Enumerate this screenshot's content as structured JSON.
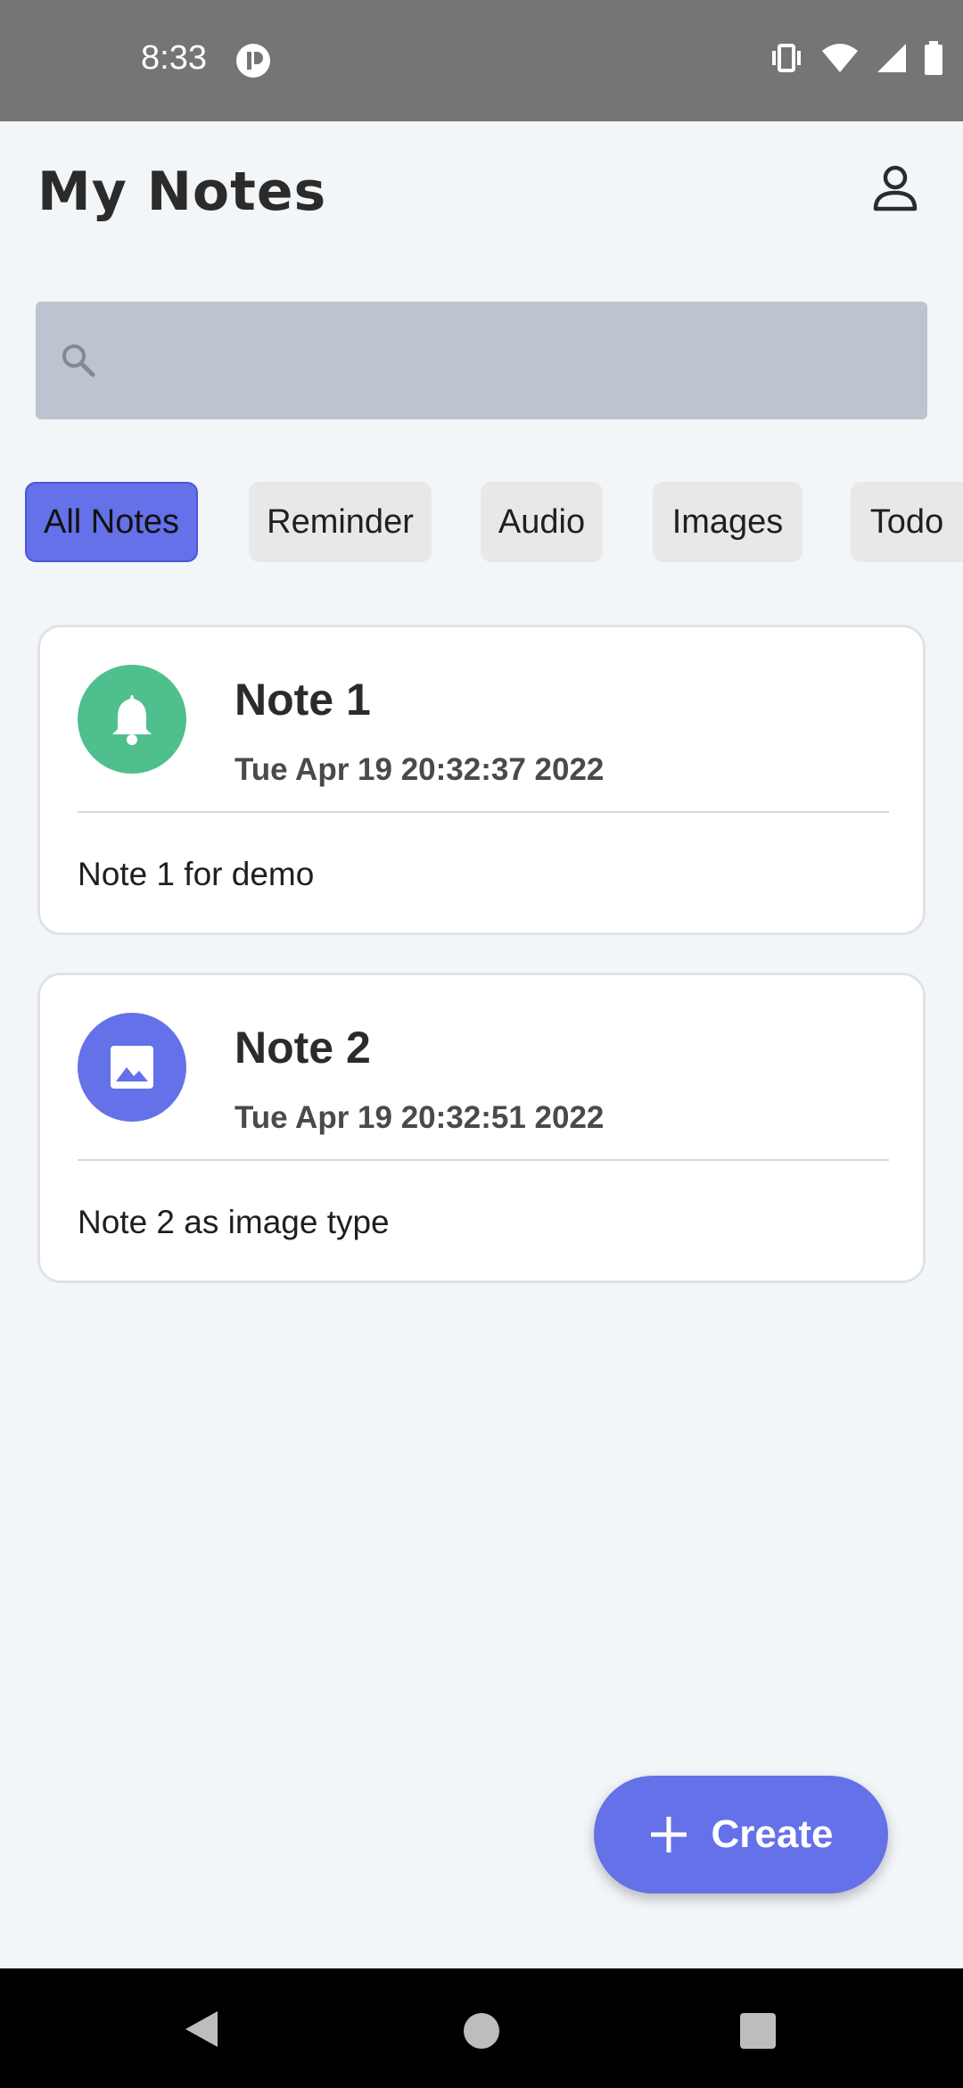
{
  "status": {
    "time": "8:33"
  },
  "header": {
    "title": "My Notes"
  },
  "search": {
    "placeholder": ""
  },
  "filters": [
    "All Notes",
    "Reminder",
    "Audio",
    "Images",
    "Todo"
  ],
  "notes": [
    {
      "title": "Note 1",
      "date": "Tue Apr 19 20:32:37 2022",
      "body": "Note 1 for demo",
      "type_icon": "bell-icon",
      "color": "#4fc08d"
    },
    {
      "title": "Note 2",
      "date": "Tue Apr 19 20:32:51 2022",
      "body": "Note 2 as image type",
      "type_icon": "image-icon",
      "color": "#6471e8"
    }
  ],
  "fab": {
    "label": "Create"
  },
  "colors": {
    "accent": "#6471e8",
    "reminder": "#4fc08d"
  }
}
